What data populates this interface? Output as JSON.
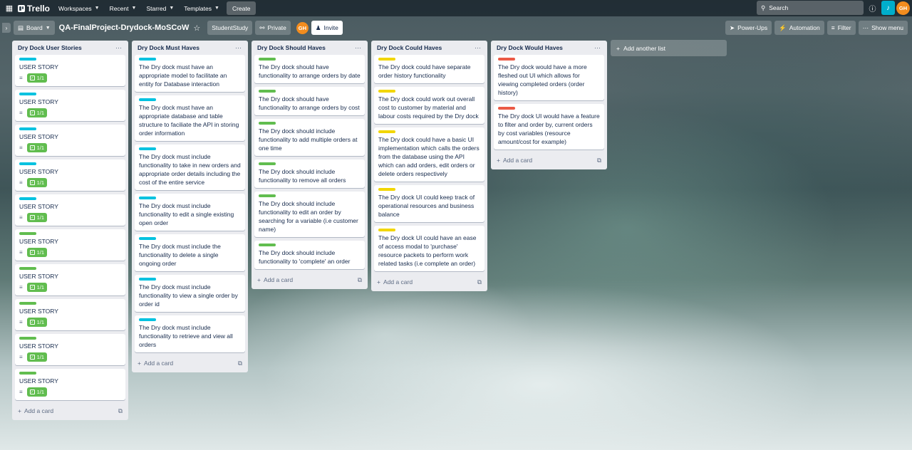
{
  "topbar": {
    "brand": "Trello",
    "nav": [
      "Workspaces",
      "Recent",
      "Starred",
      "Templates"
    ],
    "create": "Create",
    "search_placeholder": "Search",
    "avatar_initials": "GH"
  },
  "board": {
    "view": "Board",
    "title": "QA-FinalProject-Drydock-MoSCoW",
    "workspace": "StudentStudy",
    "visibility": "Private",
    "member_initials": "GH",
    "invite": "Invite",
    "power_ups": "Power-Ups",
    "automation": "Automation",
    "filter": "Filter",
    "show_menu": "Show menu",
    "add_list": "Add another list"
  },
  "colors": {
    "cyan": "#00c2e0",
    "green": "#61bd4f",
    "yellow": "#f2d600",
    "red": "#eb5a46",
    "avatar": "#f28c1e",
    "bell": "#00aecc"
  },
  "lists": [
    {
      "title": "Dry Dock User Stories",
      "add": "Add a card",
      "cards": [
        {
          "label": "cyan",
          "text": "USER STORY",
          "check": "1/1"
        },
        {
          "label": "cyan",
          "text": "USER STORY",
          "check": "1/1"
        },
        {
          "label": "cyan",
          "text": "USER STORY",
          "check": "1/1"
        },
        {
          "label": "cyan",
          "text": "USER STORY",
          "check": "1/1"
        },
        {
          "label": "cyan",
          "text": "USER STORY",
          "check": "1/1"
        },
        {
          "label": "green",
          "text": "USER STORY",
          "check": "1/1"
        },
        {
          "label": "green",
          "text": "USER STORY",
          "check": "1/1"
        },
        {
          "label": "green",
          "text": "USER STORY",
          "check": "1/1"
        },
        {
          "label": "green",
          "text": "USER STORY",
          "check": "1/1"
        },
        {
          "label": "green",
          "text": "USER STORY",
          "check": "1/1"
        }
      ]
    },
    {
      "title": "Dry Dock Must Haves",
      "add": "Add a card",
      "cards": [
        {
          "label": "cyan",
          "text": "The Dry dock must have an appropriate model to facilitate an entity for Database interaction"
        },
        {
          "label": "cyan",
          "text": "The Dry dock must have an appropriate database and table structure to faciliate the API in storing order information"
        },
        {
          "label": "cyan",
          "text": "The Dry dock must include functionality to take in new orders and appropriate order details including the cost of the entire service"
        },
        {
          "label": "cyan",
          "text": "The Dry dock must include functionality to edit a single existing open order"
        },
        {
          "label": "cyan",
          "text": "The Dry dock must include the functionality to delete a single ongoing order"
        },
        {
          "label": "cyan",
          "text": "The Dry dock must include functionality to view a single order by order id"
        },
        {
          "label": "cyan",
          "text": "The Dry dock must include functionality to retrieve and view all orders"
        }
      ]
    },
    {
      "title": "Dry Dock Should Haves",
      "add": "Add a card",
      "cards": [
        {
          "label": "green",
          "text": "The Dry dock should have functionality to arrange orders by date"
        },
        {
          "label": "green",
          "text": "The Dry dock should have functionality to arrange orders by cost"
        },
        {
          "label": "green",
          "text": "The Dry dock should include functionality to add multiple orders at one time"
        },
        {
          "label": "green",
          "text": "The Dry dock should include functionality to remove all orders"
        },
        {
          "label": "green",
          "text": "The Dry dock should include functionality to edit an order by searching for a variable (i.e customer name)"
        },
        {
          "label": "green",
          "text": "The Dry dock should include functionality to 'complete' an order"
        }
      ]
    },
    {
      "title": "Dry Dock Could Haves",
      "add": "Add a card",
      "cards": [
        {
          "label": "yellow",
          "text": "The Dry dock could have separate order history functionality"
        },
        {
          "label": "yellow",
          "text": "The Dry dock could work out overall cost to customer by material and labour costs required by the Dry dock"
        },
        {
          "label": "yellow",
          "text": "The Dry dock could have a basic UI implementation which calls the orders from the database using the API which can add orders, edit orders or delete orders respectively"
        },
        {
          "label": "yellow",
          "text": "The Dry dock UI could keep track of operational resources and business balance"
        },
        {
          "label": "yellow",
          "text": "The Dry dock UI could have an ease of access modal to 'purchase' resource packets to perform work related tasks (i.e complete an order)"
        }
      ]
    },
    {
      "title": "Dry Dock Would Haves",
      "add": "Add a card",
      "cards": [
        {
          "label": "red",
          "text": "The Dry dock would have a more fleshed out UI which allows for viewing completed orders (order history)"
        },
        {
          "label": "red",
          "text": "The Dry dock UI would have a feature to filter and order by, current orders by cost variables (resource amount/cost for example)"
        }
      ]
    }
  ]
}
